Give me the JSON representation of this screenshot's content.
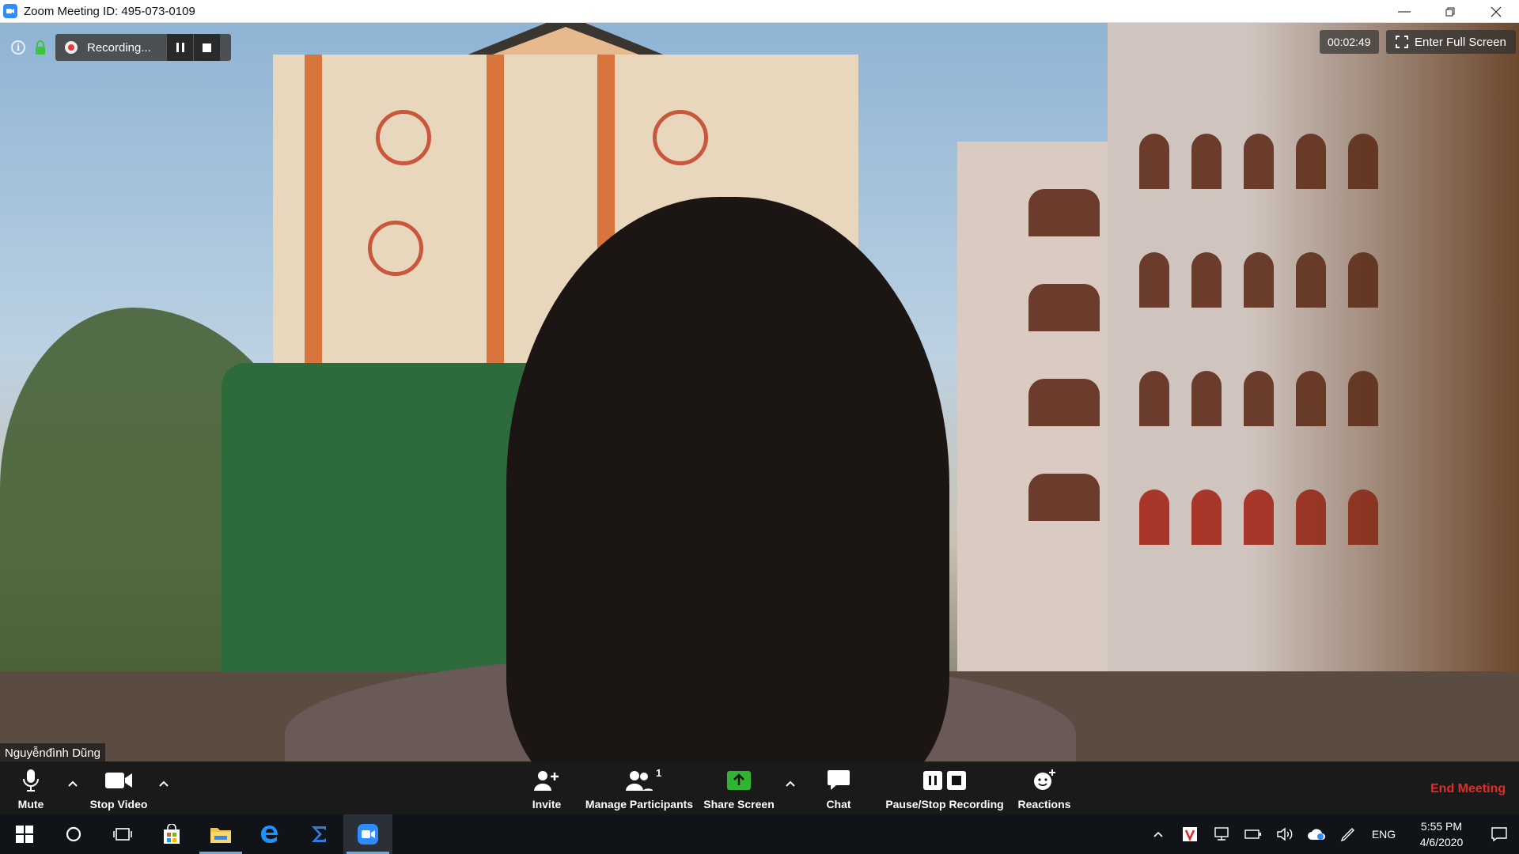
{
  "window": {
    "title": "Zoom Meeting ID: 495-073-0109"
  },
  "recording": {
    "status_text": "Recording..."
  },
  "timer": "00:02:49",
  "fullscreen_label": "Enter Full Screen",
  "participant_name": "Nguyễnđình Dũng",
  "toolbar": {
    "mute_label": "Mute",
    "stop_video_label": "Stop Video",
    "invite_label": "Invite",
    "manage_participants_label": "Manage Participants",
    "participants_count": "1",
    "share_screen_label": "Share Screen",
    "chat_label": "Chat",
    "pause_stop_recording_label": "Pause/Stop Recording",
    "reactions_label": "Reactions",
    "end_meeting_label": "End Meeting"
  },
  "taskbar": {
    "language": "ENG",
    "time": "5:55 PM",
    "date": "4/6/2020"
  },
  "colors": {
    "zoom_blue": "#2d8cff",
    "share_green": "#2fb52f",
    "end_red": "#e22c2c",
    "record_red": "#e23a3a"
  }
}
